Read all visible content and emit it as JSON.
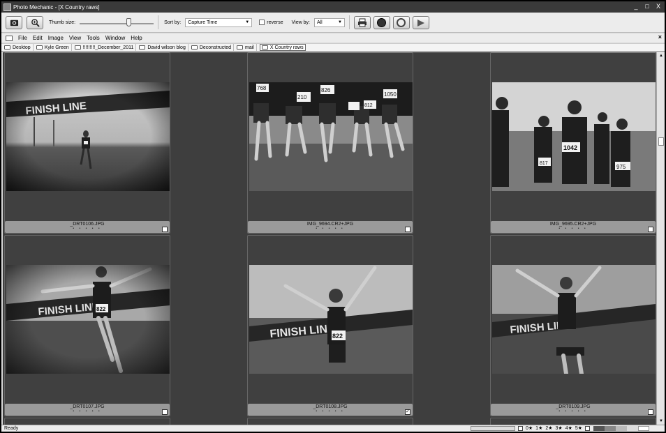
{
  "window": {
    "title": "Photo Mechanic - [X Country raws]",
    "controls": [
      "_",
      "□",
      "X"
    ]
  },
  "toolbar": {
    "thumb_size_label": "Thumb size:",
    "thumb_size_level": 0.68,
    "sort_by_label": "Sort by:",
    "sort_by_value": "Capture Time",
    "reverse_label": "reverse",
    "view_by_label": "View by:",
    "view_by_value": "All"
  },
  "menu": {
    "items": [
      "File",
      "Edit",
      "Image",
      "View",
      "Tools",
      "Window",
      "Help"
    ],
    "close": "×"
  },
  "favorites": [
    {
      "label": "Desktop"
    },
    {
      "label": "Kyle Green"
    },
    {
      "label": "!!!!!!!!!_December_2011"
    },
    {
      "label": "David wilson blog"
    },
    {
      "label": "Deconstructed"
    },
    {
      "label": "mail"
    },
    {
      "label": "X Country raws",
      "active": true
    }
  ],
  "thumbnails": [
    {
      "filename": "_DRT0106.JPG",
      "stars": "• • • • •",
      "tagged": false
    },
    {
      "filename": "IMG_9694.CR2+JPG",
      "stars": "• • • • •",
      "tagged": false
    },
    {
      "filename": "IMG_9695.CR2+JPG",
      "stars": "• • • • •",
      "tagged": false
    },
    {
      "filename": "_DRT0107.JPG",
      "stars": "• • • • •",
      "tagged": false
    },
    {
      "filename": "_DRT0108.JPG",
      "stars": "• • • • •",
      "tagged": true
    },
    {
      "filename": "_DRT0109.JPG",
      "stars": "• • • • •",
      "tagged": false
    }
  ],
  "photo_text": {
    "finish_line": "FINISH LINE",
    "bibs": [
      "768",
      "210",
      "826",
      "1050",
      "812",
      "817",
      "1042",
      "975",
      "822",
      "822"
    ]
  },
  "status": {
    "text": "Ready",
    "ratings": [
      "0★",
      "1★",
      "2★",
      "3★",
      "4★",
      "5★"
    ]
  }
}
